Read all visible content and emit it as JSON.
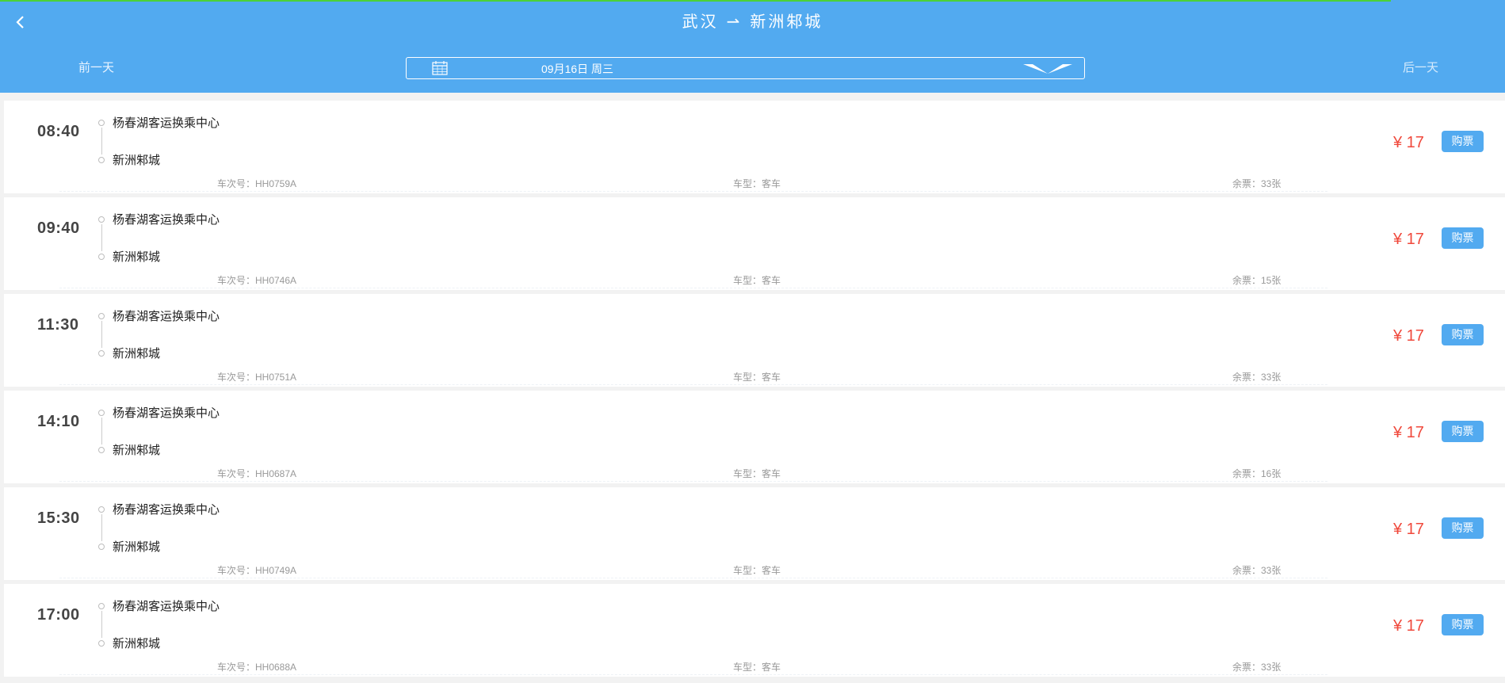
{
  "header": {
    "origin": "武汉",
    "arrow": "⇀",
    "destination": "新洲邾城",
    "prev_day": "前一天",
    "next_day": "后一天",
    "date": "09月16日 周三"
  },
  "trips": [
    {
      "time": "08:40",
      "from": "杨春湖客运换乘中心",
      "to": "新洲邾城",
      "train": "车次号：HH0759A",
      "type": "车型：客车",
      "seats": "余票：33张",
      "price": "¥ 17",
      "buy": "购票"
    },
    {
      "time": "09:40",
      "from": "杨春湖客运换乘中心",
      "to": "新洲邾城",
      "train": "车次号：HH0746A",
      "type": "车型：客车",
      "seats": "余票：15张",
      "price": "¥ 17",
      "buy": "购票"
    },
    {
      "time": "11:30",
      "from": "杨春湖客运换乘中心",
      "to": "新洲邾城",
      "train": "车次号：HH0751A",
      "type": "车型：客车",
      "seats": "余票：33张",
      "price": "¥ 17",
      "buy": "购票"
    },
    {
      "time": "14:10",
      "from": "杨春湖客运换乘中心",
      "to": "新洲邾城",
      "train": "车次号：HH0687A",
      "type": "车型：客车",
      "seats": "余票：16张",
      "price": "¥ 17",
      "buy": "购票"
    },
    {
      "time": "15:30",
      "from": "杨春湖客运换乘中心",
      "to": "新洲邾城",
      "train": "车次号：HH0749A",
      "type": "车型：客车",
      "seats": "余票：33张",
      "price": "¥ 17",
      "buy": "购票"
    },
    {
      "time": "17:00",
      "from": "杨春湖客运换乘中心",
      "to": "新洲邾城",
      "train": "车次号：HH0688A",
      "type": "车型：客车",
      "seats": "余票：33张",
      "price": "¥ 17",
      "buy": "购票"
    }
  ],
  "colors": {
    "header_bg": "#52aaf0",
    "price": "#f0493c",
    "button": "#52aaf0",
    "progress": "#4cd137"
  }
}
